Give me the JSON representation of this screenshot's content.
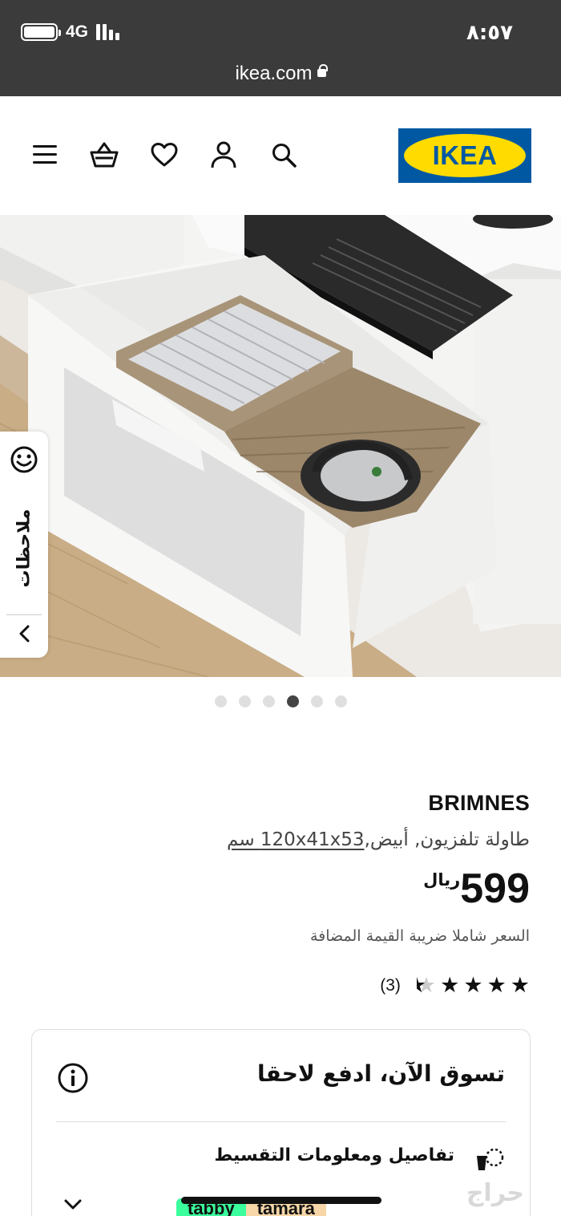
{
  "status_bar": {
    "network": "4G",
    "time": "٨:٥٧",
    "url": "ikea.com"
  },
  "header": {
    "logo_text": "IKEA",
    "icons": [
      "menu-icon",
      "basket-icon",
      "heart-icon",
      "user-icon",
      "search-icon"
    ]
  },
  "gallery": {
    "image_count": 6,
    "active_index": 3
  },
  "feedback_tab": {
    "label": "ملاحظات"
  },
  "product": {
    "name": "BRIMNES",
    "description": "طاولة تلفزيون, أبيض,",
    "dimensions": "120x41x53 سم",
    "price": "599",
    "currency": "ريال",
    "vat_note": "السعر شاملا ضريبة القيمة المضافة",
    "rating": 4.5,
    "review_count": "(3)"
  },
  "bnpl_card": {
    "title": "تسوق الآن، ادفع لاحقا",
    "installment_label": "تفاصيل ومعلومات التقسيط",
    "providers": [
      "tabby",
      "tamara"
    ]
  },
  "watermark": "حراج",
  "colors": {
    "ikea_blue": "#0058a3",
    "ikea_yellow": "#ffdb00",
    "status_bar": "#3b3b3b"
  }
}
